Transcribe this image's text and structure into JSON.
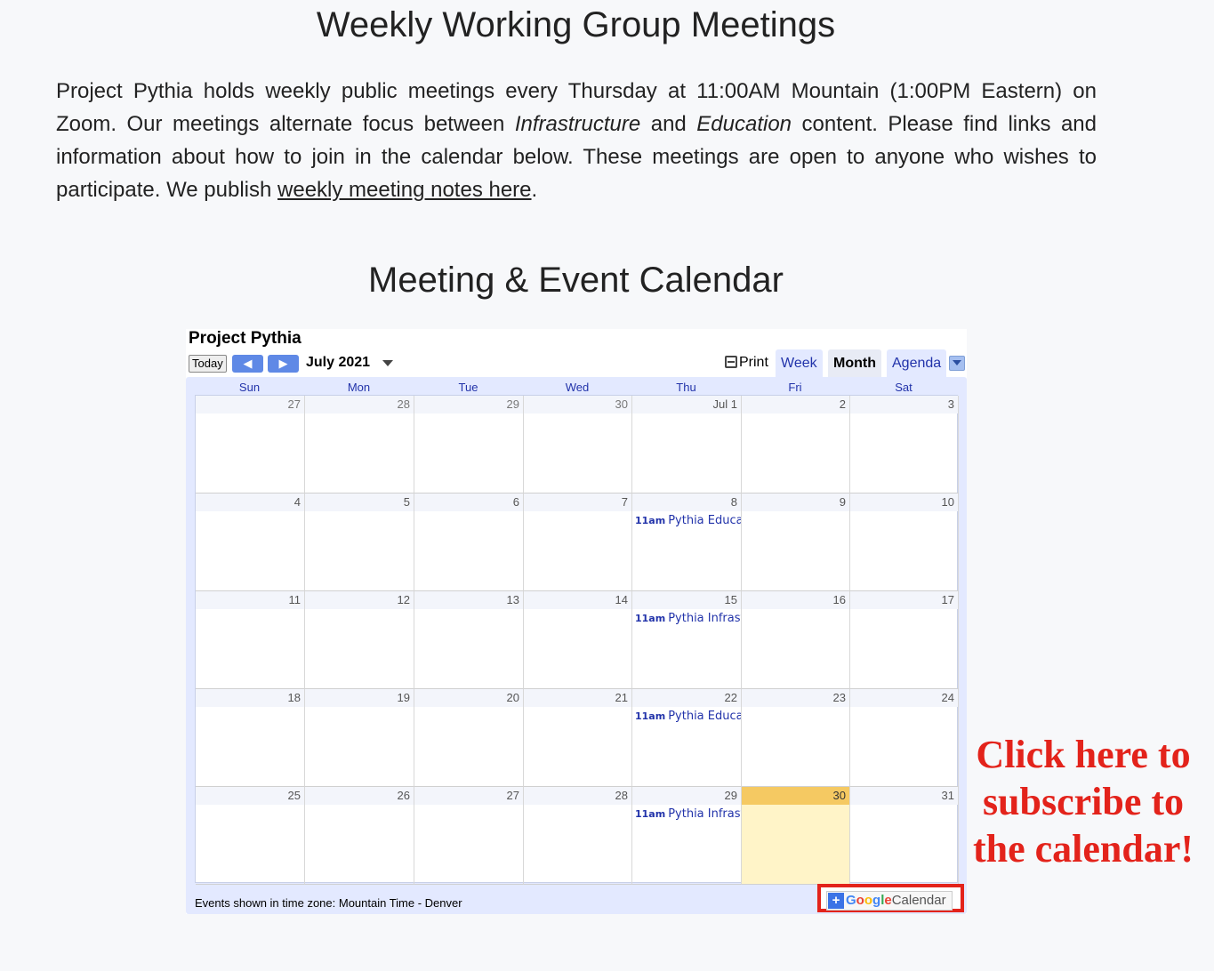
{
  "header": {
    "title": "Weekly Working Group Meetings"
  },
  "intro": {
    "part1": "Project Pythia holds weekly public meetings every Thursday at 11:00AM Mountain (1:00PM Eastern) on Zoom. Our meetings alternate focus between ",
    "em1": "Infrastructure",
    "part2": " and ",
    "em2": "Education",
    "part3": " content. Please find links and information about how to join in the calendar below. These meetings are open to anyone who wishes to participate. We publish ",
    "link": "weekly meeting notes here",
    "part4": "."
  },
  "calendar_heading": "Meeting & Event Calendar",
  "calendar": {
    "name": "Project Pythia",
    "today_label": "Today",
    "prev_glyph": "◀",
    "next_glyph": "▶",
    "month_label": "July 2021",
    "print_label": "Print",
    "tabs": {
      "week": "Week",
      "month": "Month",
      "agenda": "Agenda"
    },
    "days_of_week": [
      "Sun",
      "Mon",
      "Tue",
      "Wed",
      "Thu",
      "Fri",
      "Sat"
    ],
    "weeks": [
      [
        {
          "label": "27",
          "other": true
        },
        {
          "label": "28",
          "other": true
        },
        {
          "label": "29",
          "other": true
        },
        {
          "label": "30",
          "other": true
        },
        {
          "label": "Jul 1"
        },
        {
          "label": "2"
        },
        {
          "label": "3"
        }
      ],
      [
        {
          "label": "4"
        },
        {
          "label": "5"
        },
        {
          "label": "6"
        },
        {
          "label": "7"
        },
        {
          "label": "8",
          "event": {
            "time": "11am",
            "title": "Pythia Education"
          }
        },
        {
          "label": "9"
        },
        {
          "label": "10"
        }
      ],
      [
        {
          "label": "11"
        },
        {
          "label": "12"
        },
        {
          "label": "13"
        },
        {
          "label": "14"
        },
        {
          "label": "15",
          "event": {
            "time": "11am",
            "title": "Pythia Infrastructure"
          }
        },
        {
          "label": "16"
        },
        {
          "label": "17"
        }
      ],
      [
        {
          "label": "18"
        },
        {
          "label": "19"
        },
        {
          "label": "20"
        },
        {
          "label": "21"
        },
        {
          "label": "22",
          "event": {
            "time": "11am",
            "title": "Pythia Education"
          }
        },
        {
          "label": "23"
        },
        {
          "label": "24"
        }
      ],
      [
        {
          "label": "25"
        },
        {
          "label": "26"
        },
        {
          "label": "27"
        },
        {
          "label": "28"
        },
        {
          "label": "29",
          "event": {
            "time": "11am",
            "title": "Pythia Infrastructure"
          }
        },
        {
          "label": "30",
          "today": true
        },
        {
          "label": "31"
        }
      ]
    ],
    "timezone_text": "Events shown in time zone: Mountain Time - Denver",
    "subscribe": {
      "plus": "+",
      "google": [
        "G",
        "o",
        "o",
        "g",
        "l",
        "e"
      ],
      "calendar": "Calendar"
    },
    "colors": {
      "event": "#2233aa",
      "today_header": "#f5c962",
      "today_bg": "#fff4c8",
      "highlight": "#e3231b"
    }
  },
  "callout": {
    "lines": [
      "Click here to",
      "subscribe to",
      "the calendar!"
    ]
  }
}
